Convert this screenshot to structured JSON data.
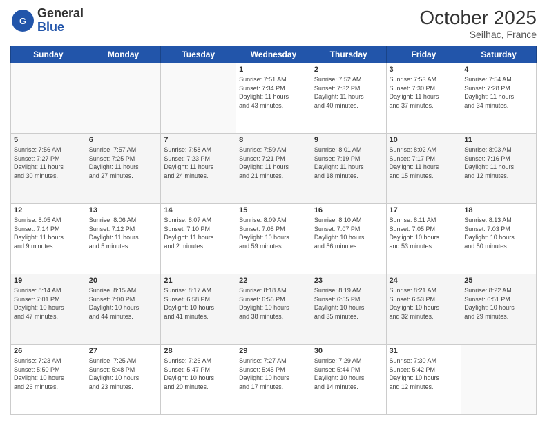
{
  "header": {
    "logo": {
      "general": "General",
      "blue": "Blue"
    },
    "title": "October 2025",
    "location": "Seilhac, France"
  },
  "days_of_week": [
    "Sunday",
    "Monday",
    "Tuesday",
    "Wednesday",
    "Thursday",
    "Friday",
    "Saturday"
  ],
  "weeks": [
    [
      {
        "day": "",
        "info": ""
      },
      {
        "day": "",
        "info": ""
      },
      {
        "day": "",
        "info": ""
      },
      {
        "day": "1",
        "info": "Sunrise: 7:51 AM\nSunset: 7:34 PM\nDaylight: 11 hours\nand 43 minutes."
      },
      {
        "day": "2",
        "info": "Sunrise: 7:52 AM\nSunset: 7:32 PM\nDaylight: 11 hours\nand 40 minutes."
      },
      {
        "day": "3",
        "info": "Sunrise: 7:53 AM\nSunset: 7:30 PM\nDaylight: 11 hours\nand 37 minutes."
      },
      {
        "day": "4",
        "info": "Sunrise: 7:54 AM\nSunset: 7:28 PM\nDaylight: 11 hours\nand 34 minutes."
      }
    ],
    [
      {
        "day": "5",
        "info": "Sunrise: 7:56 AM\nSunset: 7:27 PM\nDaylight: 11 hours\nand 30 minutes."
      },
      {
        "day": "6",
        "info": "Sunrise: 7:57 AM\nSunset: 7:25 PM\nDaylight: 11 hours\nand 27 minutes."
      },
      {
        "day": "7",
        "info": "Sunrise: 7:58 AM\nSunset: 7:23 PM\nDaylight: 11 hours\nand 24 minutes."
      },
      {
        "day": "8",
        "info": "Sunrise: 7:59 AM\nSunset: 7:21 PM\nDaylight: 11 hours\nand 21 minutes."
      },
      {
        "day": "9",
        "info": "Sunrise: 8:01 AM\nSunset: 7:19 PM\nDaylight: 11 hours\nand 18 minutes."
      },
      {
        "day": "10",
        "info": "Sunrise: 8:02 AM\nSunset: 7:17 PM\nDaylight: 11 hours\nand 15 minutes."
      },
      {
        "day": "11",
        "info": "Sunrise: 8:03 AM\nSunset: 7:16 PM\nDaylight: 11 hours\nand 12 minutes."
      }
    ],
    [
      {
        "day": "12",
        "info": "Sunrise: 8:05 AM\nSunset: 7:14 PM\nDaylight: 11 hours\nand 9 minutes."
      },
      {
        "day": "13",
        "info": "Sunrise: 8:06 AM\nSunset: 7:12 PM\nDaylight: 11 hours\nand 5 minutes."
      },
      {
        "day": "14",
        "info": "Sunrise: 8:07 AM\nSunset: 7:10 PM\nDaylight: 11 hours\nand 2 minutes."
      },
      {
        "day": "15",
        "info": "Sunrise: 8:09 AM\nSunset: 7:08 PM\nDaylight: 10 hours\nand 59 minutes."
      },
      {
        "day": "16",
        "info": "Sunrise: 8:10 AM\nSunset: 7:07 PM\nDaylight: 10 hours\nand 56 minutes."
      },
      {
        "day": "17",
        "info": "Sunrise: 8:11 AM\nSunset: 7:05 PM\nDaylight: 10 hours\nand 53 minutes."
      },
      {
        "day": "18",
        "info": "Sunrise: 8:13 AM\nSunset: 7:03 PM\nDaylight: 10 hours\nand 50 minutes."
      }
    ],
    [
      {
        "day": "19",
        "info": "Sunrise: 8:14 AM\nSunset: 7:01 PM\nDaylight: 10 hours\nand 47 minutes."
      },
      {
        "day": "20",
        "info": "Sunrise: 8:15 AM\nSunset: 7:00 PM\nDaylight: 10 hours\nand 44 minutes."
      },
      {
        "day": "21",
        "info": "Sunrise: 8:17 AM\nSunset: 6:58 PM\nDaylight: 10 hours\nand 41 minutes."
      },
      {
        "day": "22",
        "info": "Sunrise: 8:18 AM\nSunset: 6:56 PM\nDaylight: 10 hours\nand 38 minutes."
      },
      {
        "day": "23",
        "info": "Sunrise: 8:19 AM\nSunset: 6:55 PM\nDaylight: 10 hours\nand 35 minutes."
      },
      {
        "day": "24",
        "info": "Sunrise: 8:21 AM\nSunset: 6:53 PM\nDaylight: 10 hours\nand 32 minutes."
      },
      {
        "day": "25",
        "info": "Sunrise: 8:22 AM\nSunset: 6:51 PM\nDaylight: 10 hours\nand 29 minutes."
      }
    ],
    [
      {
        "day": "26",
        "info": "Sunrise: 7:23 AM\nSunset: 5:50 PM\nDaylight: 10 hours\nand 26 minutes."
      },
      {
        "day": "27",
        "info": "Sunrise: 7:25 AM\nSunset: 5:48 PM\nDaylight: 10 hours\nand 23 minutes."
      },
      {
        "day": "28",
        "info": "Sunrise: 7:26 AM\nSunset: 5:47 PM\nDaylight: 10 hours\nand 20 minutes."
      },
      {
        "day": "29",
        "info": "Sunrise: 7:27 AM\nSunset: 5:45 PM\nDaylight: 10 hours\nand 17 minutes."
      },
      {
        "day": "30",
        "info": "Sunrise: 7:29 AM\nSunset: 5:44 PM\nDaylight: 10 hours\nand 14 minutes."
      },
      {
        "day": "31",
        "info": "Sunrise: 7:30 AM\nSunset: 5:42 PM\nDaylight: 10 hours\nand 12 minutes."
      },
      {
        "day": "",
        "info": ""
      }
    ]
  ]
}
